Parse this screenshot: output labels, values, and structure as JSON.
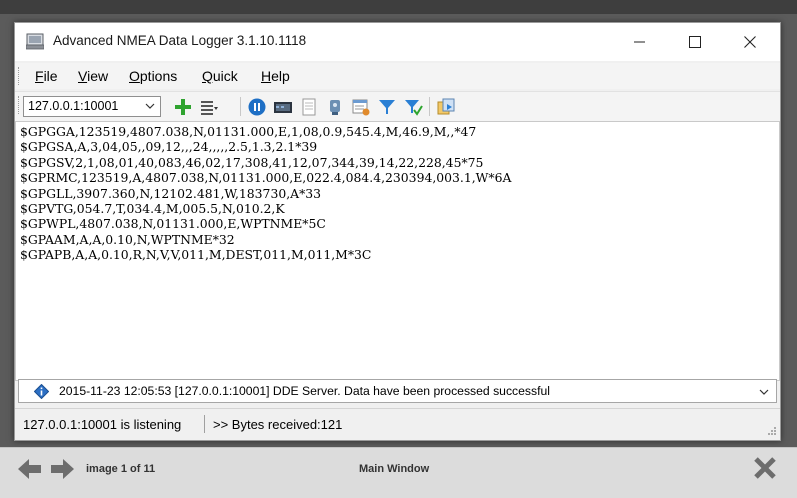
{
  "window": {
    "title": "Advanced NMEA Data Logger 3.1.10.1118",
    "controls": {
      "minimize": "—",
      "maximize": "☐",
      "close": "✕"
    }
  },
  "menu": {
    "items": [
      {
        "label_u": "F",
        "label_rest": "ile"
      },
      {
        "label_u": "V",
        "label_rest": "iew"
      },
      {
        "label_u": "O",
        "label_rest": "ptions"
      },
      {
        "label_u": "Q",
        "label_rest": "uick"
      },
      {
        "label_u": "H",
        "label_rest": "elp"
      }
    ]
  },
  "toolbar": {
    "port_value": "127.0.0.1:10001",
    "icons": [
      "add-icon",
      "columns-icon",
      "pause-icon",
      "monitor-icon",
      "document-icon",
      "plugin-icon",
      "report-icon",
      "filter-icon",
      "filter-apply-icon",
      "export-icon"
    ]
  },
  "data_lines": [
    "$GPGGA,123519,4807.038,N,01131.000,E,1,08,0.9,545.4,M,46.9,M,,*47",
    "$GPGSA,A,3,04,05,,09,12,,,24,,,,,2.5,1.3,2.1*39",
    "$GPGSV,2,1,08,01,40,083,46,02,17,308,41,12,07,344,39,14,22,228,45*75",
    "$GPRMC,123519,A,4807.038,N,01131.000,E,022.4,084.4,230394,003.1,W*6A",
    "$GPGLL,3907.360,N,12102.481,W,183730,A*33",
    "$GPVTG,054.7,T,034.4,M,005.5,N,010.2,K",
    "$GPWPL,4807.038,N,01131.000,E,WPTNME*5C",
    "$GPAAM,A,A,0.10,N,WPTNME*32",
    "$GPAPB,A,A,0.10,R,N,V,V,011,M,DEST,011,M,011,M*3C"
  ],
  "log": {
    "message": "2015-11-23 12:05:53 [127.0.0.1:10001] DDE Server. Data have been processed successful"
  },
  "status": {
    "listening": "127.0.0.1:10001 is listening",
    "bytes": ">> Bytes received:121"
  },
  "viewer": {
    "page_count": "image 1 of 11",
    "page_title": "Main Window"
  }
}
